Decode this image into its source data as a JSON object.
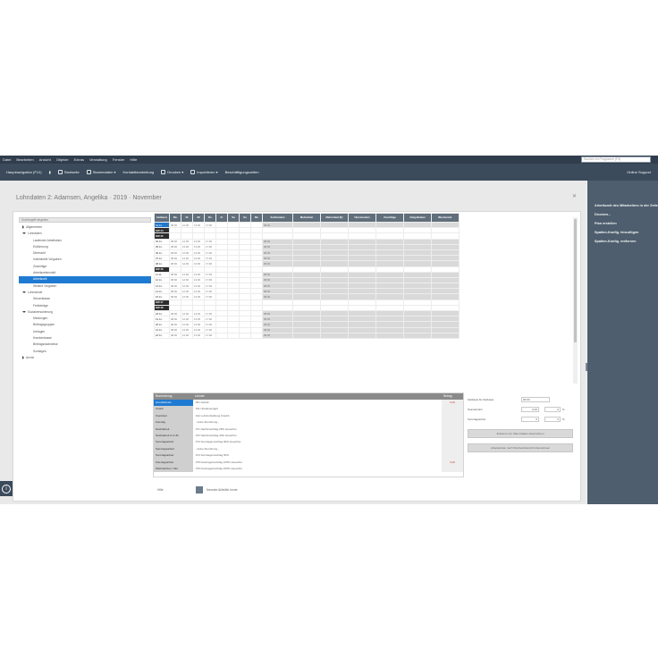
{
  "menu": [
    "Datei",
    "Bearbeiten",
    "Ansicht",
    "Objekte",
    "Extras",
    "Verwaltung",
    "Fenster",
    "Hilfe"
  ],
  "search_placeholder": "Suchen im Programm (F3)",
  "toolbar": {
    "nav": "Hauptnavigation (F12)",
    "start": "Startseite",
    "stammdaten": "Stammdaten",
    "kontakt": "Kontaktbearbeitung",
    "drucken": "Drucken",
    "importieren": "Importieren",
    "beschaeftigung": "Beschäftigungszeiten",
    "online": "Online Support"
  },
  "title": "Lohndaten 2: Adamsen, Angelika · 2019 · November",
  "right_panel": [
    "Arbeitszeit des Mitarbeiters in der Zeiterfassung",
    "Drucken...",
    "Plan erstellen",
    "Spalten-Konfig. hinzufügen",
    "Spalten-Konfig. entfernen"
  ],
  "tree": {
    "search": "Suchbegriff eingeben",
    "items": [
      {
        "label": "Allgemeines",
        "level": 1,
        "caret": "right",
        "sel": false
      },
      {
        "label": "Lohndaten",
        "level": 1,
        "caret": "down",
        "sel": false
      },
      {
        "label": "Laufender Arbeitslohn",
        "level": 2,
        "caret": "",
        "sel": false
      },
      {
        "label": "Entlohnung",
        "level": 2,
        "caret": "",
        "sel": false
      },
      {
        "label": "Übersicht",
        "level": 2,
        "caret": "",
        "sel": false
      },
      {
        "label": "Individuelle Vorgaben",
        "level": 2,
        "caret": "",
        "sel": false
      },
      {
        "label": "Zuschläge",
        "level": 2,
        "caret": "",
        "sel": false
      },
      {
        "label": "Arbeitszeitmodell",
        "level": 2,
        "caret": "",
        "sel": false
      },
      {
        "label": "Arbeitszeit",
        "level": 2,
        "caret": "",
        "sel": true
      },
      {
        "label": "Weitere Vorgaben",
        "level": 2,
        "caret": "",
        "sel": false
      },
      {
        "label": "Lohnsteuer",
        "level": 1,
        "caret": "down",
        "sel": false
      },
      {
        "label": "Steuerklasse",
        "level": 2,
        "caret": "",
        "sel": false
      },
      {
        "label": "Freibeträge",
        "level": 2,
        "caret": "",
        "sel": false
      },
      {
        "label": "Sozialversicherung",
        "level": 1,
        "caret": "down",
        "sel": false
      },
      {
        "label": "Meldungen",
        "level": 2,
        "caret": "",
        "sel": false
      },
      {
        "label": "Beitragsgruppen",
        "level": 2,
        "caret": "",
        "sel": false
      },
      {
        "label": "Umlagen",
        "level": 2,
        "caret": "",
        "sel": false
      },
      {
        "label": "Krankenkasse",
        "level": 2,
        "caret": "",
        "sel": false
      },
      {
        "label": "Beitragsnachweise",
        "level": 2,
        "caret": "",
        "sel": false
      },
      {
        "label": "Sonstiges",
        "level": 2,
        "caret": "",
        "sel": false
      },
      {
        "label": "Archiv",
        "level": 1,
        "caret": "right",
        "sel": false
      }
    ]
  },
  "grid": {
    "headers": [
      "Zeitbasis",
      "Mo",
      "Di",
      "Mi",
      "Do",
      "Fr",
      "Sa",
      "So",
      "Mo",
      "Sollstunden",
      "Mehrarbeit",
      "Mehrarbeit (K)",
      "Überstunden",
      "Zuschläge",
      "Zeitguthaben",
      "Wochenstd."
    ],
    "rows": [
      {
        "type": "day",
        "date": "01.11.",
        "hl": true,
        "v": [
          "08:00",
          "12:00",
          "13:00",
          "17:00"
        ],
        "soll": "08:00"
      },
      {
        "type": "week",
        "label": "KW 44"
      },
      {
        "type": "week",
        "label": "KW 45"
      },
      {
        "type": "day",
        "date": "04.11.",
        "v": [
          "08:00",
          "12:00",
          "13:00",
          "17:00"
        ],
        "soll": "08:00"
      },
      {
        "type": "day",
        "date": "05.11.",
        "v": [
          "08:00",
          "12:00",
          "13:00",
          "17:00"
        ],
        "soll": "08:00"
      },
      {
        "type": "day",
        "date": "06.11.",
        "v": [
          "08:00",
          "12:00",
          "13:00",
          "17:00"
        ],
        "soll": "08:00"
      },
      {
        "type": "day",
        "date": "07.11.",
        "v": [
          "08:00",
          "12:00",
          "13:00",
          "17:00"
        ],
        "soll": "08:00"
      },
      {
        "type": "day",
        "date": "08.11.",
        "v": [
          "08:00",
          "12:00",
          "13:00",
          "17:00"
        ],
        "soll": "08:00"
      },
      {
        "type": "week",
        "label": "KW 46"
      },
      {
        "type": "day",
        "date": "11.11.",
        "v": [
          "08:00",
          "12:00",
          "13:00",
          "17:00"
        ],
        "soll": "08:00"
      },
      {
        "type": "day",
        "date": "12.11.",
        "v": [
          "08:00",
          "12:00",
          "13:00",
          "17:00"
        ],
        "soll": "08:00"
      },
      {
        "type": "day",
        "date": "13.11.",
        "v": [
          "08:00",
          "12:00",
          "13:00",
          "17:00"
        ],
        "soll": "08:00"
      },
      {
        "type": "day",
        "date": "14.11.",
        "v": [
          "08:00",
          "12:00",
          "13:00",
          "17:00"
        ],
        "soll": "08:00"
      },
      {
        "type": "day",
        "date": "15.11.",
        "v": [
          "08:00",
          "12:00",
          "13:00",
          "17:00"
        ],
        "soll": "08:00"
      },
      {
        "type": "week",
        "label": "KW 47"
      },
      {
        "type": "week",
        "label": "KW 48"
      },
      {
        "type": "day",
        "date": "18.11.",
        "v": [
          "08:00",
          "12:00",
          "13:00",
          "17:00"
        ],
        "soll": "08:00"
      },
      {
        "type": "day",
        "date": "19.11.",
        "v": [
          "08:00",
          "12:00",
          "13:00",
          "17:00"
        ],
        "soll": "08:00"
      },
      {
        "type": "day",
        "date": "20.11.",
        "v": [
          "08:00",
          "12:00",
          "13:00",
          "17:00"
        ],
        "soll": "08:00"
      },
      {
        "type": "day",
        "date": "21.11.",
        "v": [
          "08:00",
          "12:00",
          "13:00",
          "17:00"
        ],
        "soll": "08:00"
      },
      {
        "type": "day",
        "date": "22.11.",
        "v": [
          "08:00",
          "12:00",
          "13:00",
          "17:00"
        ],
        "soll": "08:00"
      }
    ]
  },
  "lower": {
    "headers": [
      "Bezeichnung",
      "Lohnart",
      "Betrag"
    ],
    "rows": [
      {
        "name": "Grundlohnart",
        "desc": "001 Gehalt",
        "val": "0,00",
        "sel": true
      },
      {
        "name": "Urlaub",
        "desc": "011 Urlaubsentgelt",
        "val": "",
        "sel": false
      },
      {
        "name": "Krankheit",
        "desc": "012 Lohnfortzahlung Krankh.",
        "val": "",
        "sel": false
      },
      {
        "name": "Feiertag",
        "desc": "- keine Zuordnung -",
        "val": "",
        "sel": false
      },
      {
        "name": "Nachtarbeit",
        "desc": "071 Nachtzuschlag 25% steuerfrei",
        "val": "",
        "sel": false
      },
      {
        "name": "Nachtarbeit 0-4 Uhr",
        "desc": "072 Nachtzuschlag 40% steuerfrei",
        "val": "",
        "sel": false
      },
      {
        "name": "Sonntagsarbeit",
        "desc": "073 Sonntagszuschlag 50% steuerfrei",
        "val": "",
        "sel": false
      },
      {
        "name": "Samstagsarbeit",
        "desc": "- keine Zuordnung -",
        "val": "",
        "sel": false
      },
      {
        "name": "Sonntagsarbeit",
        "desc": "074 Sonntagszuschlag 50%",
        "val": "",
        "sel": false
      },
      {
        "name": "Feiertagsarbeit",
        "desc": "075 Feiertagszuschlag 125% steuerfrei",
        "val": "0,00",
        "sel": false
      },
      {
        "name": "Weihnachten / Silv.",
        "desc": "076 Feiertagszuschlag 150% steuerfrei",
        "val": "",
        "sel": false
      }
    ]
  },
  "settings": {
    "rows": [
      {
        "label": "Zeitbasis für Zeitbasis",
        "value": "00:00",
        "unit": ""
      },
      {
        "label": "Stundenlohn",
        "value": "0,00",
        "unit": "%",
        "extra": "0"
      },
      {
        "label": "Sonntagsarbeit",
        "value": "0",
        "unit": "%",
        "extra": "0"
      }
    ],
    "btn1": "Zeitraum von Stammdaten übernehmen",
    "btn2": "Arbeitszeiten nach Wochenübersicht übernehmen"
  },
  "footer": {
    "left": "Hilfe",
    "right": "Neueste Aktivität: heute"
  }
}
